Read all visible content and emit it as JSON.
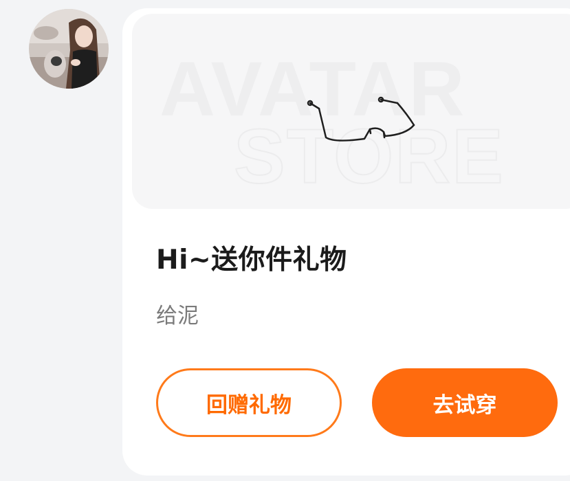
{
  "sender": {
    "avatar_icon": "user-avatar"
  },
  "gift_card": {
    "banner_watermark_line1": "AVATAR",
    "banner_watermark_line2": "STORE",
    "gift_item_icon": "glasses-icon",
    "title": "Hi~送你件礼物",
    "subtitle": "给泥",
    "return_gift_label": "回赠礼物",
    "try_on_label": "去试穿"
  },
  "colors": {
    "accent": "#ff6b0e",
    "background": "#f3f4f6",
    "card": "#ffffff",
    "banner": "#f6f6f7"
  }
}
